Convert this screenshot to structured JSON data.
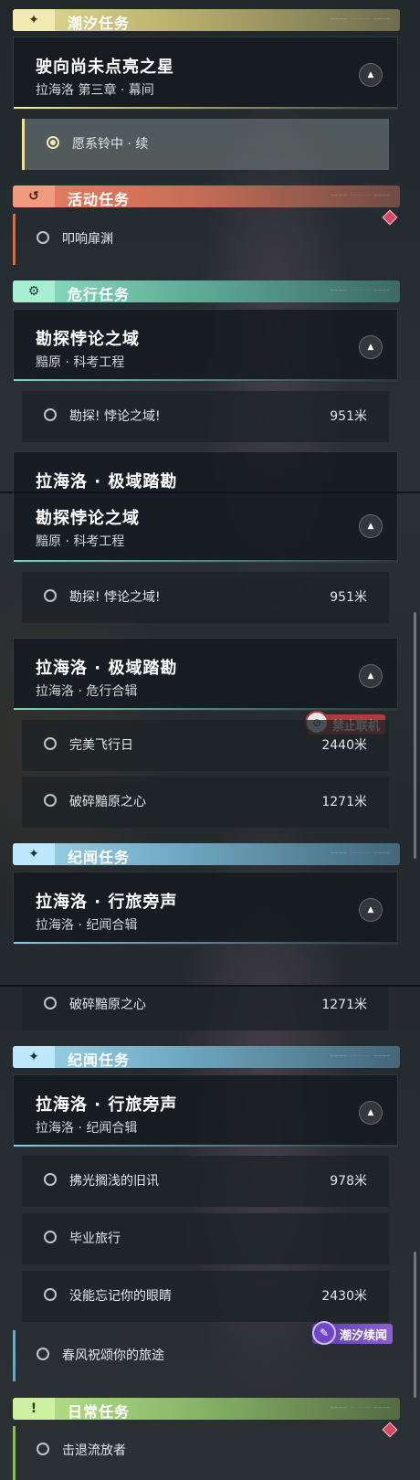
{
  "sections": {
    "tide": {
      "title": "潮汐任务",
      "icon": "sparkle-icon"
    },
    "activity": {
      "title": "活动任务",
      "icon": "return-icon"
    },
    "danger": {
      "title": "危行任务",
      "icon": "gear-eye-icon"
    },
    "story": {
      "title": "纪闻任务",
      "icon": "sparkle-icon"
    },
    "daily": {
      "title": "日常任务",
      "icon": "exclamation-icon"
    }
  },
  "header_deco": "──── ········ ────",
  "cards": {
    "tide": {
      "title": "驶向尚未点亮之星",
      "subtitle": "拉海洛 第三章 · 幕间"
    },
    "explore": {
      "title": "勘探悖论之域",
      "subtitle": "黯原 · 科考工程"
    },
    "polar": {
      "title": "拉海洛 · 极域踏勘",
      "subtitle": "拉海洛 · 危行合辑"
    },
    "travel": {
      "title": "拉海洛 · 行旅旁声",
      "subtitle": "拉海洛 · 纪闻合辑"
    }
  },
  "quests": {
    "wish": {
      "label": "愿系铃中 · 续"
    },
    "knock": {
      "label": "叩响扉渊"
    },
    "explore": {
      "label": "勘探! 悖论之域!",
      "distance": "951米"
    },
    "flight": {
      "label": "完美飞行日",
      "distance": "2440米"
    },
    "shatter": {
      "label": "破碎黯原之心",
      "distance": "1271米"
    },
    "light": {
      "label": "拂光搁浅的旧讯",
      "distance": "978米"
    },
    "graduate": {
      "label": "毕业旅行"
    },
    "eyes": {
      "label": "没能忘记你的眼睛",
      "distance": "2430米"
    },
    "spring": {
      "label": "春风祝颂你的旅途"
    },
    "repel": {
      "label": "击退流放者"
    }
  },
  "badges": {
    "offline": "禁止联机",
    "tide_story": "潮汐续闻"
  },
  "partial_title": "拉海洛 · 极域踏勘",
  "colors": {
    "tide": "#e6dd92",
    "activity": "#ea7f62",
    "danger": "#8fe2c4",
    "story": "#9ed6ee",
    "daily": "#bce68a"
  }
}
